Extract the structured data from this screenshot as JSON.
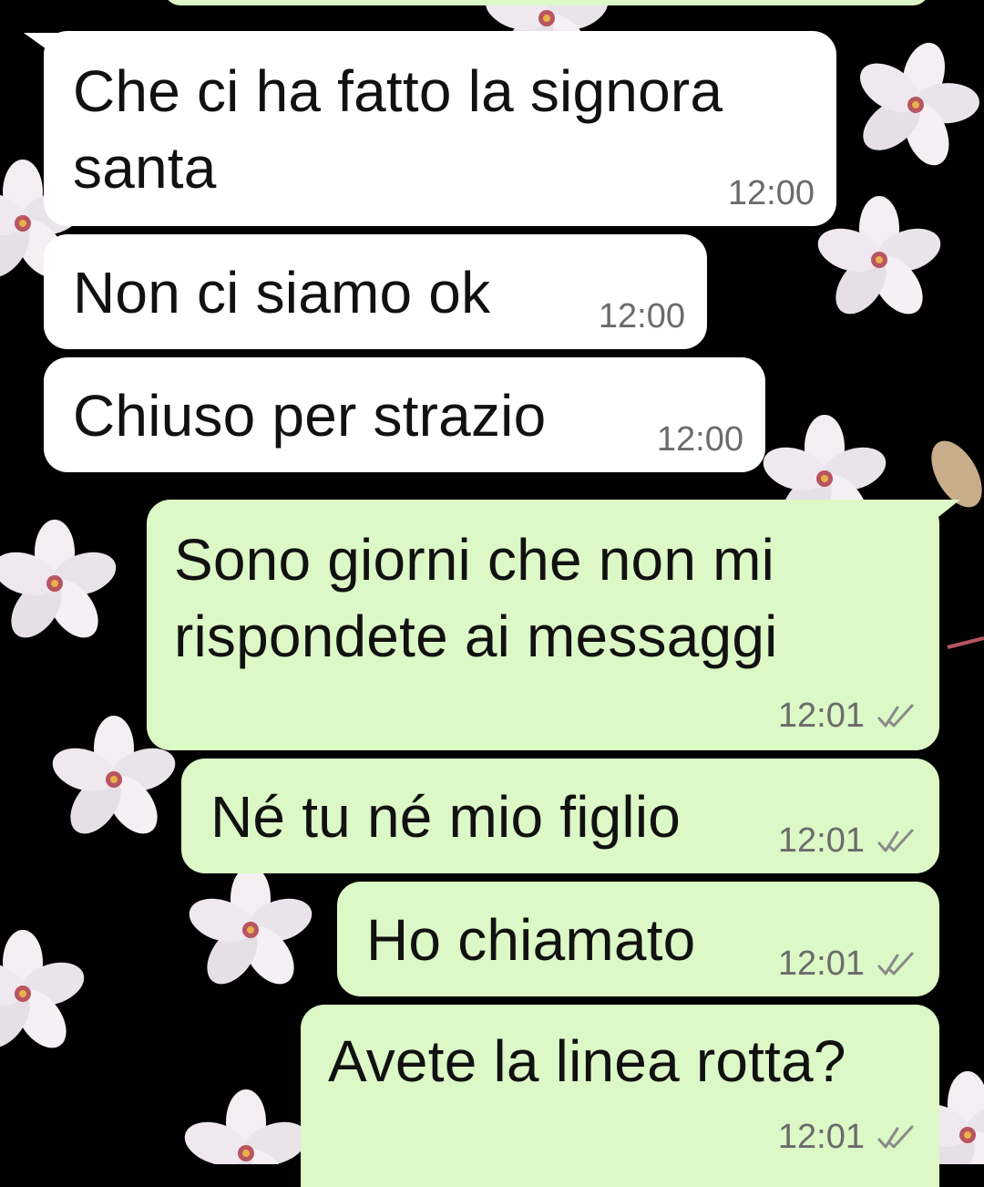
{
  "chat": {
    "messages": [
      {
        "direction": "incoming",
        "text_lines": [
          "Che ci ha fatto la signora",
          "santa"
        ],
        "time": "12:00",
        "ticks": ""
      },
      {
        "direction": "incoming",
        "text_lines": [
          "Non ci siamo ok"
        ],
        "time": "12:00",
        "ticks": ""
      },
      {
        "direction": "incoming",
        "text_lines": [
          "Chiuso per strazio"
        ],
        "time": "12:00",
        "ticks": ""
      },
      {
        "direction": "outgoing",
        "text_lines": [
          "Sono giorni che non mi",
          "rispondete ai messaggi"
        ],
        "time": "12:01",
        "ticks": "double-check-icon"
      },
      {
        "direction": "outgoing",
        "text_lines": [
          "Né tu né mio figlio"
        ],
        "time": "12:01",
        "ticks": "double-check-icon"
      },
      {
        "direction": "outgoing",
        "text_lines": [
          "Ho chiamato"
        ],
        "time": "12:01",
        "ticks": "double-check-icon"
      },
      {
        "direction": "outgoing",
        "text_lines": [
          "Avete la linea rotta?"
        ],
        "time": "12:01",
        "ticks": "double-check-icon"
      }
    ]
  },
  "colors": {
    "incoming_bubble": "#ffffff",
    "outgoing_bubble": "#dcf8c6",
    "wallpaper": "#000000",
    "timestamp": "#6b6b6b",
    "ticks": "#8a8a8a"
  }
}
